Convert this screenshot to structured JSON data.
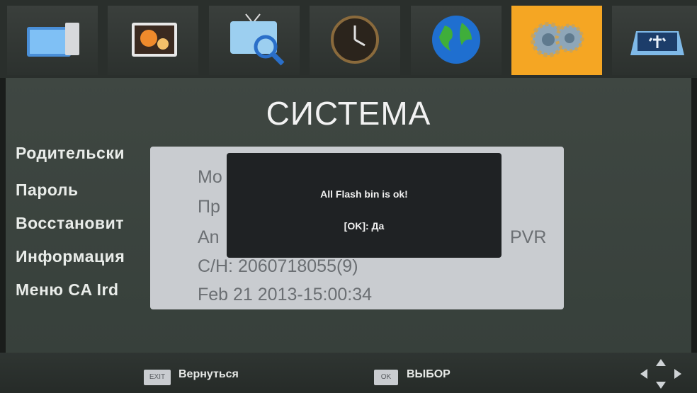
{
  "tabs": [
    {
      "icon": "tv-screen-icon",
      "active": false
    },
    {
      "icon": "pictures-icon",
      "active": false
    },
    {
      "icon": "tv-search-icon",
      "active": false
    },
    {
      "icon": "clock-icon",
      "active": false
    },
    {
      "icon": "globe-icon",
      "active": false
    },
    {
      "icon": "gear-icon",
      "active": true
    },
    {
      "icon": "usb-icon",
      "active": false
    }
  ],
  "page": {
    "title": "СИСТЕМА"
  },
  "menu": {
    "items": [
      {
        "label": "Родительски"
      },
      {
        "label": "Пароль"
      },
      {
        "label": "Восстановит"
      },
      {
        "label": "Информация"
      },
      {
        "label": "Меню CA Ird"
      }
    ]
  },
  "info": {
    "lines": [
      {
        "text": "Mo"
      },
      {
        "text": "Пр"
      },
      {
        "text": "An"
      },
      {
        "text": "C/H:    2060718055(9)"
      },
      {
        "text": "Feb 21 2013-15:00:34"
      }
    ],
    "suffix": "PVR"
  },
  "popup": {
    "message": "All Flash bin is ok!",
    "ok": "[OK]: Да"
  },
  "footer": {
    "exit_key": "EXIT",
    "back_label": "Вернуться",
    "ok_key": "OK",
    "select_label": "ВЫБОР"
  },
  "colors": {
    "accent": "#f5a623",
    "panel": "#c9ccd0",
    "popup": "#1f2224"
  }
}
